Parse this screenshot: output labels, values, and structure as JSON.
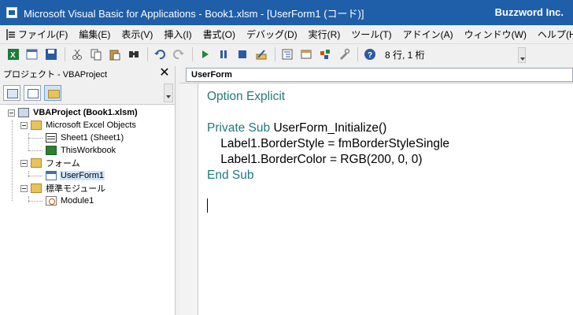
{
  "window": {
    "title": "Microsoft Visual Basic for Applications - Book1.xlsm - [UserForm1 (コード)]",
    "brand": "Buzzword Inc."
  },
  "menu": [
    "ファイル(F)",
    "編集(E)",
    "表示(V)",
    "挿入(I)",
    "書式(O)",
    "デバッグ(D)",
    "実行(R)",
    "ツール(T)",
    "アドイン(A)",
    "ウィンドウ(W)",
    "ヘルプ(H)"
  ],
  "toolbar": {
    "position": "8 行, 1 桁",
    "icons": [
      "excel-view-icon",
      "insert-userform-icon",
      "save-icon",
      "cut-icon",
      "copy-icon",
      "paste-icon",
      "find-icon",
      "undo-icon",
      "redo-icon",
      "run-icon",
      "break-icon",
      "reset-icon",
      "design-mode-icon",
      "project-explorer-icon",
      "properties-icon",
      "object-browser-icon",
      "toolbox-icon",
      "help-icon"
    ]
  },
  "project": {
    "header": "プロジェクト - VBAProject",
    "tree": {
      "root": "VBAProject (Book1.xlsm)",
      "excel_objects": "Microsoft Excel Objects",
      "sheet1": "Sheet1 (Sheet1)",
      "thisworkbook": "ThisWorkbook",
      "forms": "フォーム",
      "userform1": "UserForm1",
      "modules": "標準モジュール",
      "module1": "Module1"
    }
  },
  "editor": {
    "object_combo": "UserForm",
    "lines": [
      {
        "kw": "Option Explicit",
        "text": ""
      },
      {
        "kw": "",
        "text": ""
      },
      {
        "kw": "Private Sub",
        "text": " UserForm_Initialize()"
      },
      {
        "kw": "",
        "text": "    Label1.BorderStyle = fmBorderStyleSingle"
      },
      {
        "kw": "",
        "text": "    Label1.BorderColor = RGB(200, 0, 0)"
      },
      {
        "kw": "End Sub",
        "text": ""
      }
    ]
  }
}
